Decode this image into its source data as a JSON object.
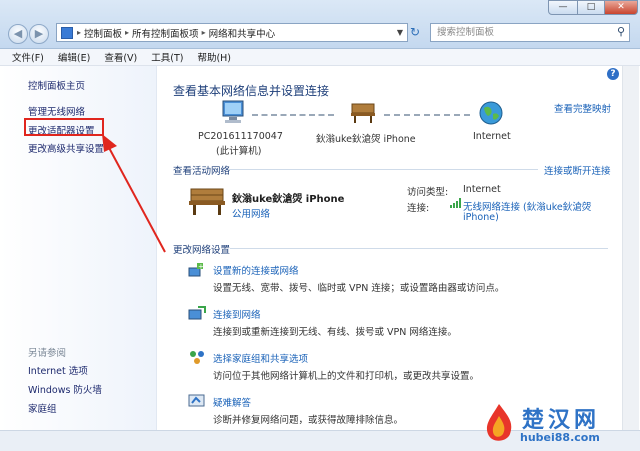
{
  "window": {
    "breadcrumb": [
      "控制面板",
      "所有控制面板项",
      "网络和共享中心"
    ],
    "search_placeholder": "搜索控制面板",
    "controls": [
      "—",
      "□",
      "✕"
    ]
  },
  "menu": [
    "文件(F)",
    "编辑(E)",
    "查看(V)",
    "工具(T)",
    "帮助(H)"
  ],
  "sidebar": {
    "home": "控制面板主页",
    "items": [
      "管理无线网络",
      "更改适配器设置",
      "更改高级共享设置"
    ],
    "see_also_title": "另请参阅",
    "see_also": [
      "Internet 选项",
      "Windows 防火墙",
      "家庭组"
    ]
  },
  "main": {
    "title": "查看基本网络信息并设置连接",
    "full_map_link": "查看完整映射",
    "map": {
      "computer_name": "PC201611170047",
      "computer_sub": "(此计算机)",
      "network_name": "鈥滃uke鈥滄焈 iPhone",
      "internet": "Internet"
    },
    "active_title": "查看活动网络",
    "connect_link": "连接或断开连接",
    "active": {
      "name": "鈥滃uke鈥滄焈 iPhone",
      "type": "公用网络",
      "access_label": "访问类型:",
      "access_value": "Internet",
      "conn_label": "连接:",
      "conn_value_1": "无线网络连接 (鈥滃uke鈥滄焈",
      "conn_value_2": "iPhone)"
    },
    "change_title": "更改网络设置",
    "tasks": [
      {
        "link": "设置新的连接或网络",
        "desc": "设置无线、宽带、拨号、临时或 VPN 连接；或设置路由器或访问点。"
      },
      {
        "link": "连接到网络",
        "desc": "连接到或重新连接到无线、有线、拨号或 VPN 网络连接。"
      },
      {
        "link": "选择家庭组和共享选项",
        "desc": "访问位于其他网络计算机上的文件和打印机，或更改共享设置。"
      },
      {
        "link": "疑难解答",
        "desc": "诊断并修复网络问题，或获得故障排除信息。"
      }
    ]
  },
  "watermark": {
    "title": "楚汉网",
    "url": "hubei88.com"
  },
  "colors": {
    "annotation": "#e0261e",
    "link": "#1a62b8",
    "heading": "#1e3f7a"
  }
}
